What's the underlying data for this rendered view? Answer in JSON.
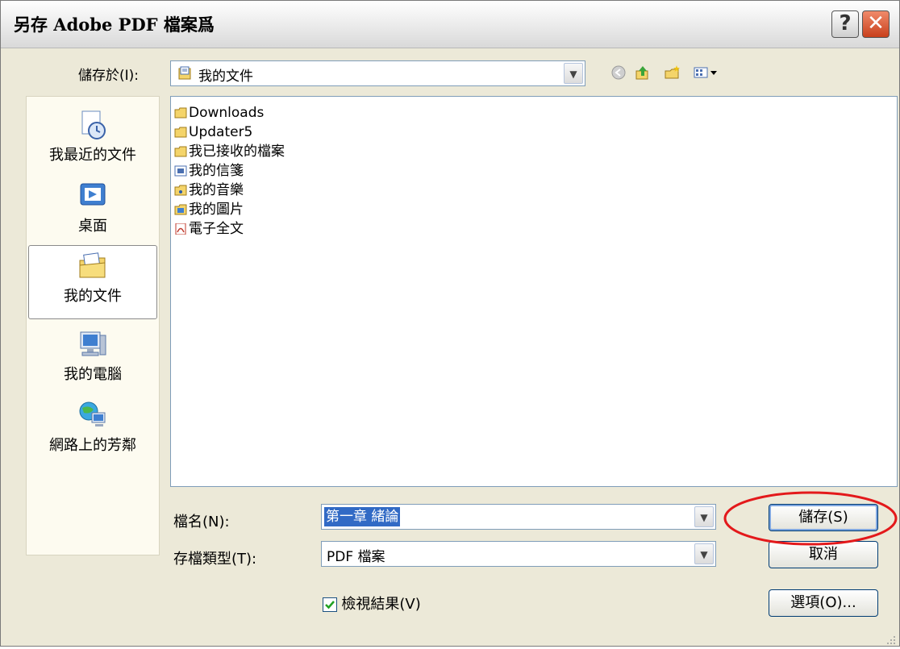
{
  "dialog": {
    "title": "另存 Adobe PDF 檔案爲",
    "help_label": "?",
    "close_label": "✕"
  },
  "save_in": {
    "label": "儲存於(I):",
    "value": "我的文件"
  },
  "toolbar": {
    "icons": [
      "back-icon",
      "up-folder-icon",
      "new-folder-icon",
      "view-menu-icon"
    ]
  },
  "places": [
    {
      "label": "我最近的文件",
      "icon": "recent-documents-icon"
    },
    {
      "label": "桌面",
      "icon": "desktop-icon"
    },
    {
      "label": "我的文件",
      "icon": "my-documents-icon",
      "selected": true
    },
    {
      "label": "我的電腦",
      "icon": "my-computer-icon"
    },
    {
      "label": "網路上的芳鄰",
      "icon": "network-places-icon"
    }
  ],
  "files": [
    {
      "name": "Downloads",
      "icon": "folder-icon"
    },
    {
      "name": "Updater5",
      "icon": "folder-icon"
    },
    {
      "name": "我已接收的檔案",
      "icon": "folder-icon"
    },
    {
      "name": "我的信箋",
      "icon": "stationery-folder-icon"
    },
    {
      "name": "我的音樂",
      "icon": "music-folder-icon"
    },
    {
      "name": "我的圖片",
      "icon": "pictures-folder-icon"
    },
    {
      "name": "電子全文",
      "icon": "pdf-file-icon"
    }
  ],
  "filename": {
    "label": "檔名(N):",
    "value": "第一章 緒論"
  },
  "filetype": {
    "label": "存檔類型(T):",
    "value": "PDF 檔案"
  },
  "view_result": {
    "label": "檢視結果(V)",
    "checked": true
  },
  "buttons": {
    "save": "儲存(S)",
    "cancel": "取消",
    "options": "選項(O)..."
  },
  "colors": {
    "highlight_circle": "#e3191b",
    "selection": "#316ac5",
    "title_close": "#c8401c"
  }
}
